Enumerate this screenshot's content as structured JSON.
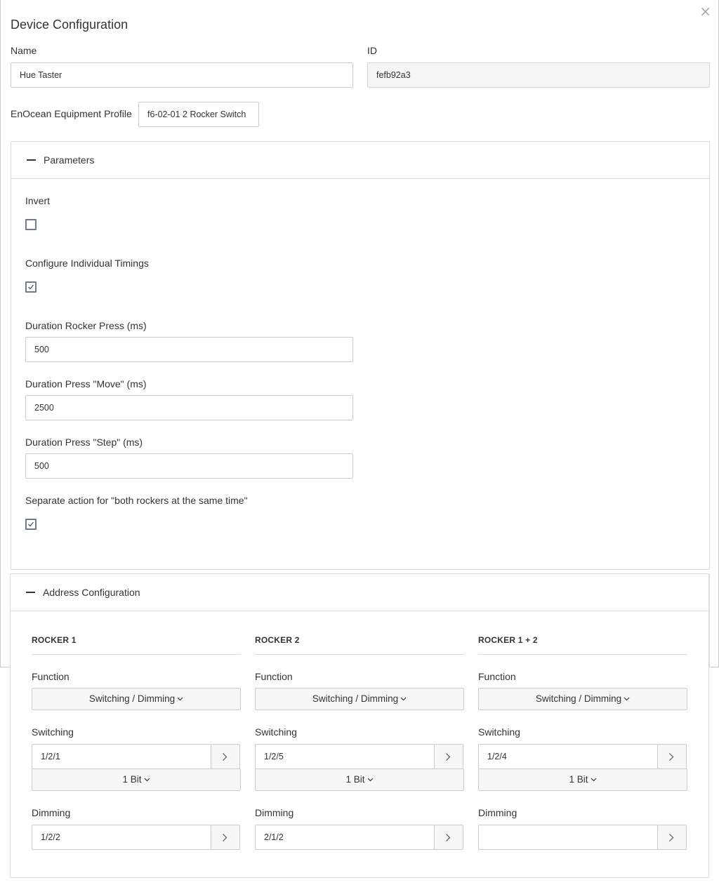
{
  "dialog": {
    "title": "Device Configuration",
    "close_glyph": "×"
  },
  "fields": {
    "name_label": "Name",
    "name_value": "Hue Taster",
    "id_label": "ID",
    "id_value": "fefb92a3",
    "profile_label": "EnOcean Equipment Profile",
    "profile_value": "f6-02-01 2 Rocker Switch"
  },
  "parameters": {
    "title": "Parameters",
    "invert_label": "Invert",
    "invert_checked": false,
    "individual_timings_label": "Configure Individual Timings",
    "individual_timings_checked": true,
    "rocker_press_label": "Duration Rocker Press (ms)",
    "rocker_press_value": "500",
    "press_move_label": "Duration Press \"Move\" (ms)",
    "press_move_value": "2500",
    "press_step_label": "Duration Press \"Step\" (ms)",
    "press_step_value": "500",
    "separate_action_label": "Separate action for \"both rockers at the same time\"",
    "separate_action_checked": true
  },
  "address_config": {
    "title": "Address Configuration",
    "columns": [
      {
        "header": "ROCKER 1",
        "function_label": "Function",
        "function_value": "Switching / Dimming",
        "switching_label": "Switching",
        "switching_address": "1/2/1",
        "switching_type": "1 Bit",
        "dimming_label": "Dimming",
        "dimming_address": "1/2/2"
      },
      {
        "header": "ROCKER 2",
        "function_label": "Function",
        "function_value": "Switching / Dimming",
        "switching_label": "Switching",
        "switching_address": "1/2/5",
        "switching_type": "1 Bit",
        "dimming_label": "Dimming",
        "dimming_address": "2/1/2"
      },
      {
        "header": "ROCKER 1 + 2",
        "function_label": "Function",
        "function_value": "Switching / Dimming",
        "switching_label": "Switching",
        "switching_address": "1/2/4",
        "switching_type": "1 Bit",
        "dimming_label": "Dimming",
        "dimming_address": ""
      }
    ]
  },
  "icons": {
    "close": "close-icon",
    "collapse": "minus-icon",
    "check": "check-icon",
    "chevron_down": "chevron-down-icon",
    "chevron_right": "chevron-right-icon"
  }
}
